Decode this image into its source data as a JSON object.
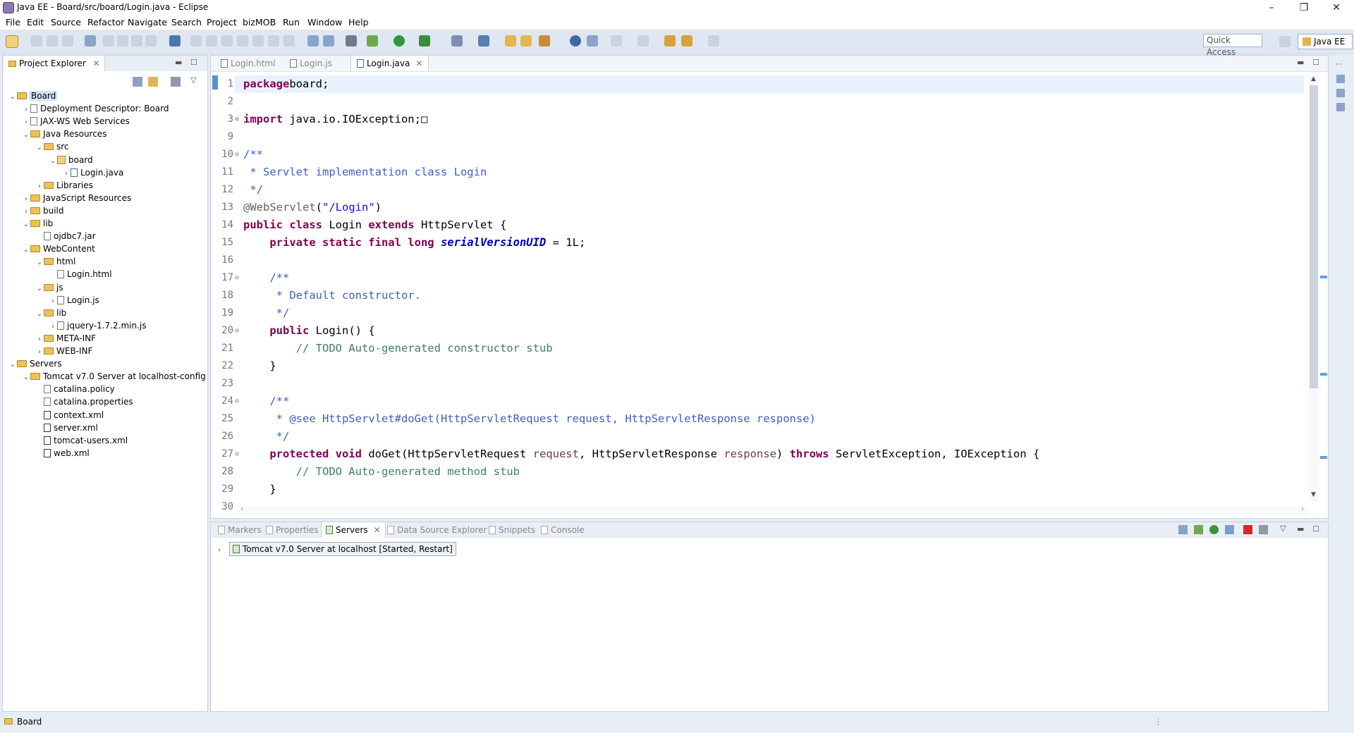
{
  "window": {
    "title": "Java EE - Board/src/board/Login.java - Eclipse"
  },
  "menu": [
    "File",
    "Edit",
    "Source",
    "Refactor",
    "Navigate",
    "Search",
    "Project",
    "bizMOB",
    "Run",
    "Window",
    "Help"
  ],
  "toolbar": {
    "quick_access": "Quick Access",
    "perspective": "Java EE"
  },
  "project_explorer": {
    "title": "Project Explorer",
    "tree": [
      {
        "label": "Board",
        "level": 0,
        "expanded": true,
        "icon": "project-icon",
        "selected": true
      },
      {
        "label": "Deployment Descriptor: Board",
        "level": 1,
        "expanded": false,
        "icon": "deployment-icon"
      },
      {
        "label": "JAX-WS Web Services",
        "level": 1,
        "expanded": false,
        "icon": "webservice-icon"
      },
      {
        "label": "Java Resources",
        "level": 1,
        "expanded": true,
        "icon": "java-resources-icon"
      },
      {
        "label": "src",
        "level": 2,
        "expanded": true,
        "icon": "source-folder-icon"
      },
      {
        "label": "board",
        "level": 3,
        "expanded": true,
        "icon": "package-icon"
      },
      {
        "label": "Login.java",
        "level": 4,
        "expanded": false,
        "icon": "java-file-icon"
      },
      {
        "label": "Libraries",
        "level": 2,
        "expanded": false,
        "icon": "library-icon"
      },
      {
        "label": "JavaScript Resources",
        "level": 1,
        "expanded": false,
        "icon": "js-resources-icon"
      },
      {
        "label": "build",
        "level": 1,
        "expanded": false,
        "icon": "folder-icon"
      },
      {
        "label": "lib",
        "level": 1,
        "expanded": true,
        "icon": "folder-icon"
      },
      {
        "label": "ojdbc7.jar",
        "level": 2,
        "leaf": true,
        "icon": "jar-file-icon"
      },
      {
        "label": "WebContent",
        "level": 1,
        "expanded": true,
        "icon": "folder-icon"
      },
      {
        "label": "html",
        "level": 2,
        "expanded": true,
        "icon": "folder-icon"
      },
      {
        "label": "Login.html",
        "level": 3,
        "leaf": true,
        "icon": "html-file-icon"
      },
      {
        "label": "js",
        "level": 2,
        "expanded": true,
        "icon": "folder-icon"
      },
      {
        "label": "Login.js",
        "level": 3,
        "expanded": false,
        "icon": "js-file-icon"
      },
      {
        "label": "lib",
        "level": 2,
        "expanded": true,
        "icon": "folder-icon"
      },
      {
        "label": "jquery-1.7.2.min.js",
        "level": 3,
        "expanded": false,
        "icon": "js-file-icon"
      },
      {
        "label": "META-INF",
        "level": 2,
        "expanded": false,
        "icon": "folder-icon"
      },
      {
        "label": "WEB-INF",
        "level": 2,
        "expanded": false,
        "icon": "folder-icon"
      },
      {
        "label": "Servers",
        "level": 0,
        "expanded": true,
        "icon": "folder-icon"
      },
      {
        "label": "Tomcat v7.0 Server at localhost-config",
        "level": 1,
        "expanded": true,
        "icon": "folder-icon"
      },
      {
        "label": "catalina.policy",
        "level": 2,
        "leaf": true,
        "icon": "file-icon"
      },
      {
        "label": "catalina.properties",
        "level": 2,
        "leaf": true,
        "icon": "file-icon"
      },
      {
        "label": "context.xml",
        "level": 2,
        "leaf": true,
        "icon": "xml-file-icon"
      },
      {
        "label": "server.xml",
        "level": 2,
        "leaf": true,
        "icon": "xml-file-icon"
      },
      {
        "label": "tomcat-users.xml",
        "level": 2,
        "leaf": true,
        "icon": "xml-file-icon"
      },
      {
        "label": "web.xml",
        "level": 2,
        "leaf": true,
        "icon": "xml-file-icon"
      }
    ]
  },
  "editor": {
    "tabs": [
      {
        "label": "Login.html",
        "active": false
      },
      {
        "label": "Login.js",
        "active": false
      },
      {
        "label": "Login.java",
        "active": true
      }
    ],
    "lines": [
      {
        "n": "1",
        "fold": "",
        "segs": [
          [
            "kw",
            "package"
          ],
          [
            "",
            "board;"
          ]
        ]
      },
      {
        "n": "2",
        "fold": "",
        "segs": []
      },
      {
        "n": "3",
        "fold": "⊕",
        "segs": [
          [
            "kw",
            "import"
          ],
          [
            "",
            " java.io.IOException;"
          ],
          [
            "",
            "□"
          ]
        ]
      },
      {
        "n": "9",
        "fold": "",
        "segs": []
      },
      {
        "n": "10",
        "fold": "⊖",
        "segs": [
          [
            "cm",
            "/**"
          ]
        ]
      },
      {
        "n": "11",
        "fold": "",
        "segs": [
          [
            "cm",
            " * Servlet implementation class Login"
          ]
        ]
      },
      {
        "n": "12",
        "fold": "",
        "segs": [
          [
            "cm",
            " */"
          ]
        ]
      },
      {
        "n": "13",
        "fold": "",
        "segs": [
          [
            "ann",
            "@WebServlet"
          ],
          [
            "",
            "("
          ],
          [
            "str",
            "\"/Login\""
          ],
          [
            "",
            ")"
          ]
        ]
      },
      {
        "n": "14",
        "fold": "",
        "segs": [
          [
            "kw",
            "public class"
          ],
          [
            "",
            " Login "
          ],
          [
            "kw",
            "extends"
          ],
          [
            "",
            " HttpServlet {"
          ]
        ]
      },
      {
        "n": "15",
        "fold": "",
        "segs": [
          [
            "",
            "    "
          ],
          [
            "kw",
            "private static final long"
          ],
          [
            "",
            " "
          ],
          [
            "fld",
            "serialVersionUID"
          ],
          [
            "",
            " = 1L;"
          ]
        ]
      },
      {
        "n": "16",
        "fold": "",
        "segs": []
      },
      {
        "n": "17",
        "fold": "⊖",
        "segs": [
          [
            "cm",
            "    /**"
          ]
        ]
      },
      {
        "n": "18",
        "fold": "",
        "segs": [
          [
            "cm",
            "     * Default constructor."
          ]
        ]
      },
      {
        "n": "19",
        "fold": "",
        "segs": [
          [
            "cm",
            "     */"
          ]
        ]
      },
      {
        "n": "20",
        "fold": "⊖",
        "segs": [
          [
            "",
            "    "
          ],
          [
            "kw",
            "public"
          ],
          [
            "",
            " Login() {"
          ]
        ]
      },
      {
        "n": "21",
        "fold": "",
        "segs": [
          [
            "tc",
            "        // TODO Auto-generated constructor stub"
          ]
        ]
      },
      {
        "n": "22",
        "fold": "",
        "segs": [
          [
            "",
            "    }"
          ]
        ]
      },
      {
        "n": "23",
        "fold": "",
        "segs": []
      },
      {
        "n": "24",
        "fold": "⊖",
        "segs": [
          [
            "cm",
            "    /**"
          ]
        ]
      },
      {
        "n": "25",
        "fold": "",
        "segs": [
          [
            "cm",
            "     * @see HttpServlet#doGet(HttpServletRequest request, HttpServletResponse response)"
          ]
        ]
      },
      {
        "n": "26",
        "fold": "",
        "segs": [
          [
            "cm",
            "     */"
          ]
        ]
      },
      {
        "n": "27",
        "fold": "⊖",
        "segs": [
          [
            "",
            "    "
          ],
          [
            "kw",
            "protected void"
          ],
          [
            "",
            " doGet(HttpServletRequest "
          ],
          [
            "prm",
            "request"
          ],
          [
            "",
            ", HttpServletResponse "
          ],
          [
            "prm",
            "response"
          ],
          [
            "",
            ") "
          ],
          [
            "kw",
            "throws"
          ],
          [
            "",
            " ServletException, IOException {"
          ]
        ]
      },
      {
        "n": "28",
        "fold": "",
        "segs": [
          [
            "tc",
            "        // TODO Auto-generated method stub"
          ]
        ]
      },
      {
        "n": "29",
        "fold": "",
        "segs": [
          [
            "",
            "    }"
          ]
        ]
      },
      {
        "n": "30",
        "fold": "",
        "segs": []
      }
    ]
  },
  "bottom_panel": {
    "tabs": [
      {
        "label": "Markers",
        "active": false,
        "icon": "markers-icon"
      },
      {
        "label": "Properties",
        "active": false,
        "icon": "properties-icon"
      },
      {
        "label": "Servers",
        "active": true,
        "icon": "servers-icon"
      },
      {
        "label": "Data Source Explorer",
        "active": false,
        "icon": "datasource-icon"
      },
      {
        "label": "Snippets",
        "active": false,
        "icon": "snippets-icon"
      },
      {
        "label": "Console",
        "active": false,
        "icon": "console-icon"
      }
    ],
    "server_entry": "Tomcat v7.0 Server at localhost  [Started, Restart]"
  },
  "status": {
    "text": "Board"
  },
  "colors": {
    "toolbar_bg": "#dfe7f2",
    "keyword": "#7f0055",
    "javadoc": "#3f5fbf",
    "todo": "#3f7f5f",
    "string": "#2a00ff"
  }
}
